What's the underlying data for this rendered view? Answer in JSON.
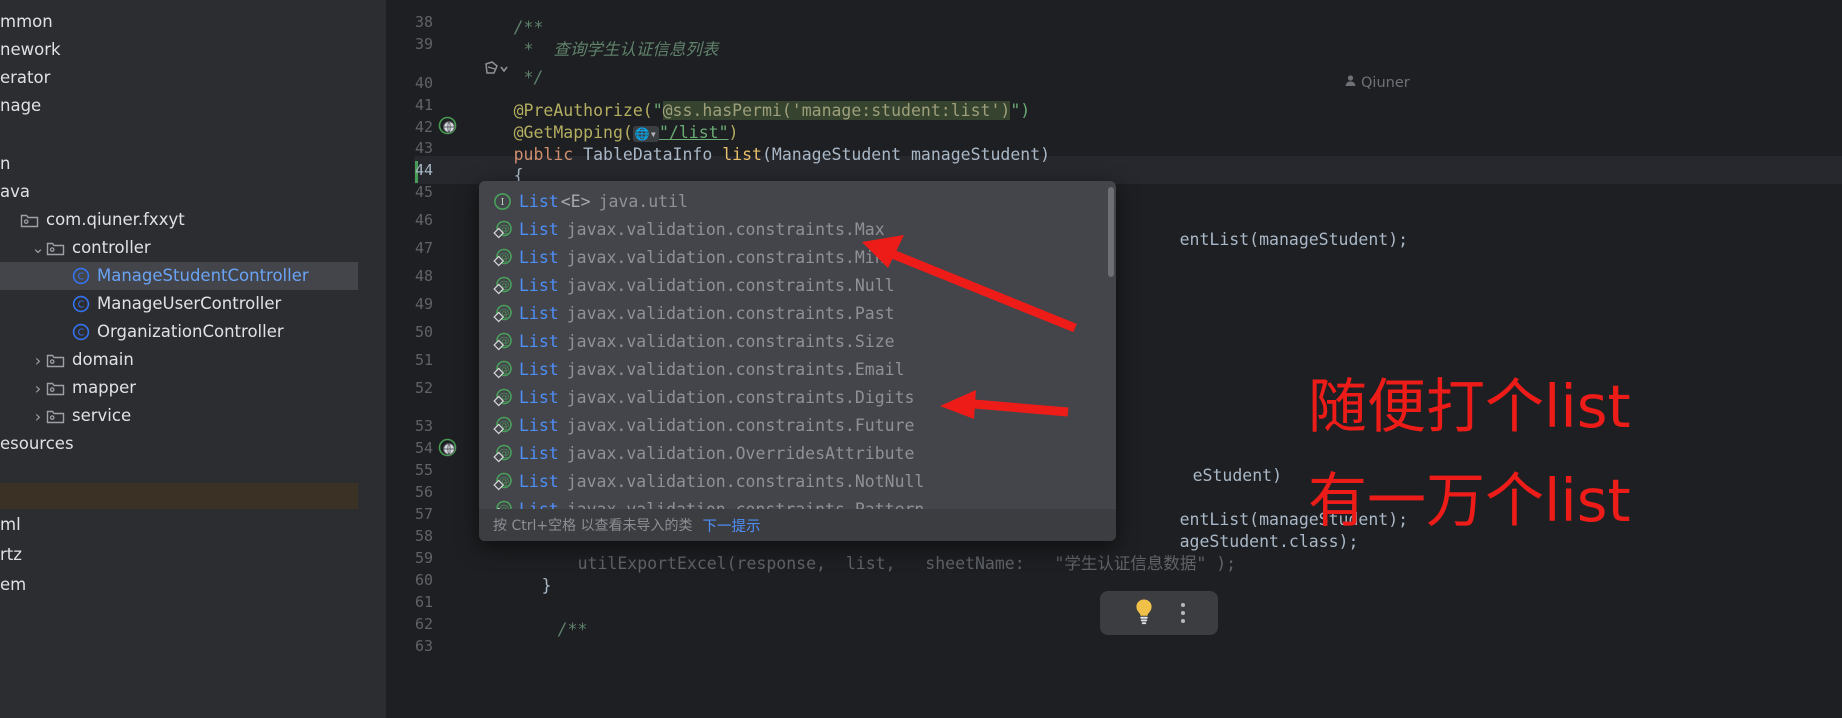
{
  "app": {
    "theme_bg": "#2b2d30",
    "editor_bg": "#1e1f22",
    "accent": "#4f8ef7",
    "annotation_color": "#ee1c18"
  },
  "sidebar": {
    "items": [
      {
        "label": "mmon",
        "indent": 0,
        "twisty": "",
        "icon": "none",
        "selected": false,
        "clipped": true
      },
      {
        "label": "nework",
        "indent": 0,
        "twisty": "",
        "icon": "none",
        "selected": false,
        "clipped": true
      },
      {
        "label": "erator",
        "indent": 0,
        "twisty": "",
        "icon": "none",
        "selected": false,
        "clipped": true
      },
      {
        "label": "nage",
        "indent": 0,
        "twisty": "",
        "icon": "none",
        "selected": false,
        "clipped": true
      },
      {
        "label": "n",
        "indent": 0,
        "twisty": "",
        "icon": "none",
        "selected": false,
        "clipped": true
      },
      {
        "label": "ava",
        "indent": 0,
        "twisty": "",
        "icon": "none",
        "selected": false,
        "clipped": true
      },
      {
        "label": "com.qiuner.fxxyt",
        "indent": 0,
        "twisty": "",
        "icon": "package",
        "selected": false,
        "clipped": false
      },
      {
        "label": "controller",
        "indent": 1,
        "twisty": "v",
        "icon": "package",
        "selected": false,
        "clipped": false
      },
      {
        "label": "ManageStudentController",
        "indent": 2,
        "twisty": "",
        "icon": "class",
        "selected": true,
        "clipped": false
      },
      {
        "label": "ManageUserController",
        "indent": 2,
        "twisty": "",
        "icon": "class",
        "selected": false,
        "clipped": false
      },
      {
        "label": "OrganizationController",
        "indent": 2,
        "twisty": "",
        "icon": "class",
        "selected": false,
        "clipped": false
      },
      {
        "label": "domain",
        "indent": 1,
        "twisty": ">",
        "icon": "package",
        "selected": false,
        "clipped": false
      },
      {
        "label": "mapper",
        "indent": 1,
        "twisty": ">",
        "icon": "package",
        "selected": false,
        "clipped": false
      },
      {
        "label": "service",
        "indent": 1,
        "twisty": ">",
        "icon": "package",
        "selected": false,
        "clipped": false
      },
      {
        "label": "esources",
        "indent": 0,
        "twisty": "",
        "icon": "none",
        "selected": false,
        "clipped": true
      },
      {
        "label": "ml",
        "indent": 0,
        "twisty": "",
        "icon": "none",
        "selected": false,
        "clipped": true
      },
      {
        "label": "rtz",
        "indent": 0,
        "twisty": "",
        "icon": "none",
        "selected": false,
        "clipped": true
      },
      {
        "label": "em",
        "indent": 0,
        "twisty": "",
        "icon": "none",
        "selected": false,
        "clipped": true
      }
    ]
  },
  "editor": {
    "line_numbers": [
      "38",
      "39",
      "40",
      "41",
      "42",
      "43",
      "44",
      "45",
      "46",
      "47",
      "48",
      "49",
      "50",
      "51",
      "52",
      "53",
      "54",
      "55",
      "56",
      "57",
      "58",
      "59",
      "60",
      "61",
      "62",
      "63"
    ],
    "current_line": "44",
    "author_hint": "Qiuner",
    "lines": {
      "l37_comment_open": "/**",
      "l38_comment": " *  查询学生认证信息列表",
      "l39_comment_close": " */",
      "l40_pre": "@PreAuthorize(",
      "l40_quote_open": "\"",
      "l40_perm": "@ss.hasPermi('manage:student:list')",
      "l40_tail": "\")",
      "l41_getmapping": "@GetMapping(",
      "l41_path": "\"/list\"",
      "l41_close": ")",
      "l42_kw": "public",
      "l42_type": "TableDataInfo",
      "l42_name": "list",
      "l42_params": "(ManageStudent manageStudent)",
      "l43_brace": "{",
      "l44_typed": "List",
      "l62_brace_close": "}",
      "l63_comment": "/**"
    },
    "right_fragments": {
      "frag_a": "entList(manageStudent);",
      "frag_b": "eStudent)",
      "frag_c": "entList(manageStudent);",
      "frag_d": "ageStudent.class);",
      "frag_e": "utilExportExcel(response,  list,   sheetName:   \"学生认证信息数据\" );"
    }
  },
  "completion": {
    "items": [
      {
        "icon": "interface",
        "name": "List",
        "generics": "<E>",
        "pkg": "java.util"
      },
      {
        "icon": "annotation",
        "name": "List",
        "generics": "",
        "pkg": "javax.validation.constraints.Max"
      },
      {
        "icon": "annotation",
        "name": "List",
        "generics": "",
        "pkg": "javax.validation.constraints.Min"
      },
      {
        "icon": "annotation",
        "name": "List",
        "generics": "",
        "pkg": "javax.validation.constraints.Null"
      },
      {
        "icon": "annotation",
        "name": "List",
        "generics": "",
        "pkg": "javax.validation.constraints.Past"
      },
      {
        "icon": "annotation",
        "name": "List",
        "generics": "",
        "pkg": "javax.validation.constraints.Size"
      },
      {
        "icon": "annotation",
        "name": "List",
        "generics": "",
        "pkg": "javax.validation.constraints.Email"
      },
      {
        "icon": "annotation",
        "name": "List",
        "generics": "",
        "pkg": "javax.validation.constraints.Digits"
      },
      {
        "icon": "annotation",
        "name": "List",
        "generics": "",
        "pkg": "javax.validation.constraints.Future"
      },
      {
        "icon": "annotation",
        "name": "List",
        "generics": "",
        "pkg": "javax.validation.OverridesAttribute"
      },
      {
        "icon": "annotation",
        "name": "List",
        "generics": "",
        "pkg": "javax.validation.constraints.NotNull"
      },
      {
        "icon": "annotation",
        "name": "List",
        "generics": "",
        "pkg": "javax.validation.constraints.Pattern"
      }
    ],
    "footer_hint": "按 Ctrl+空格 以查看未导入的类",
    "footer_action": "下一提示"
  },
  "annotations": {
    "line1": "随便打个list",
    "line2": "有一万个list"
  }
}
